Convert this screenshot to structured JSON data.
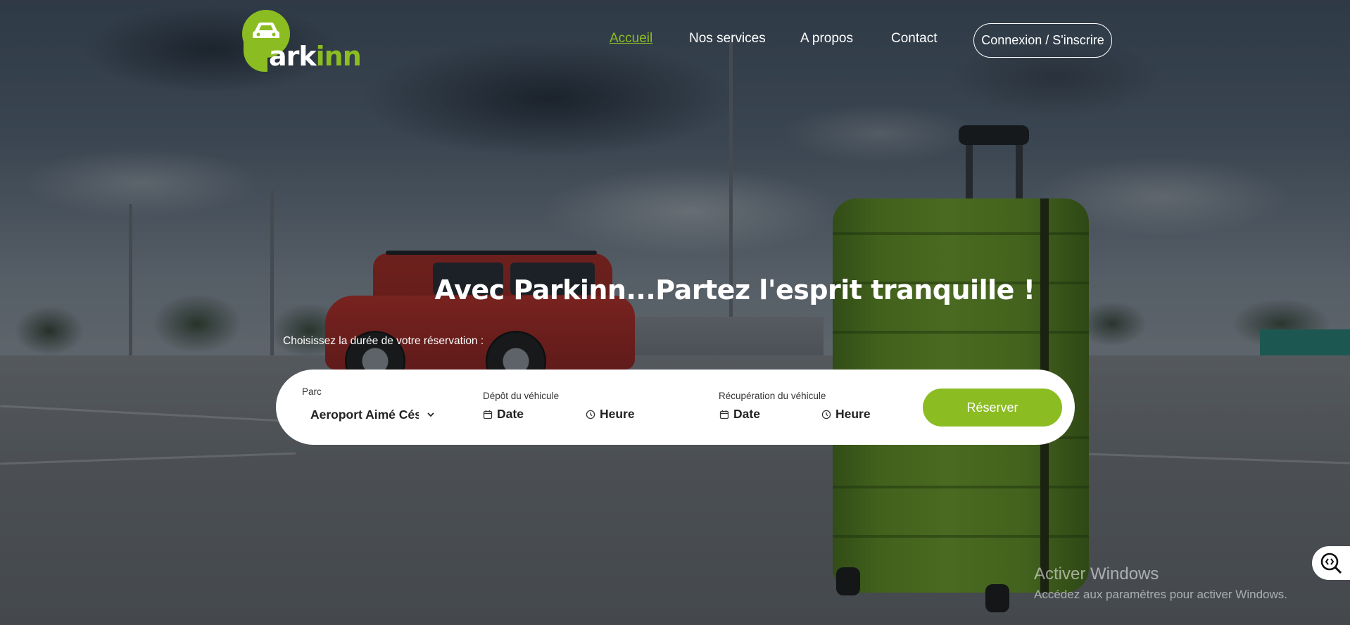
{
  "brand": {
    "logo_part1": "P",
    "logo_part2": "ark",
    "logo_part3": "inn",
    "accent_color": "#8bbd22"
  },
  "nav": {
    "items": [
      {
        "label": "Accueil",
        "active": true
      },
      {
        "label": "Nos services",
        "active": false
      },
      {
        "label": "A propos",
        "active": false
      },
      {
        "label": "Contact",
        "active": false
      }
    ],
    "login_label": "Connexion / S'inscrire"
  },
  "hero": {
    "title": "Avec Parkinn...Partez l'esprit tranquille !",
    "subtitle": "Choisissez la durée de votre réservation :"
  },
  "booking": {
    "parc_label": "Parc",
    "parc_value": "Aeroport Aimé Césaire",
    "depot_label": "Dépôt du véhicule",
    "depot_date": "Date",
    "depot_time": "Heure",
    "recup_label": "Récupération du véhicule",
    "recup_date": "Date",
    "recup_time": "Heure",
    "reserve_label": "Réserver"
  },
  "icons": {
    "calendar": "calendar-icon",
    "clock": "clock-icon",
    "chevron": "chevron-down-icon",
    "accessibility": "zoom-icon"
  },
  "watermark": {
    "title": "Activer Windows",
    "subtitle": "Accédez aux paramètres pour activer Windows."
  }
}
